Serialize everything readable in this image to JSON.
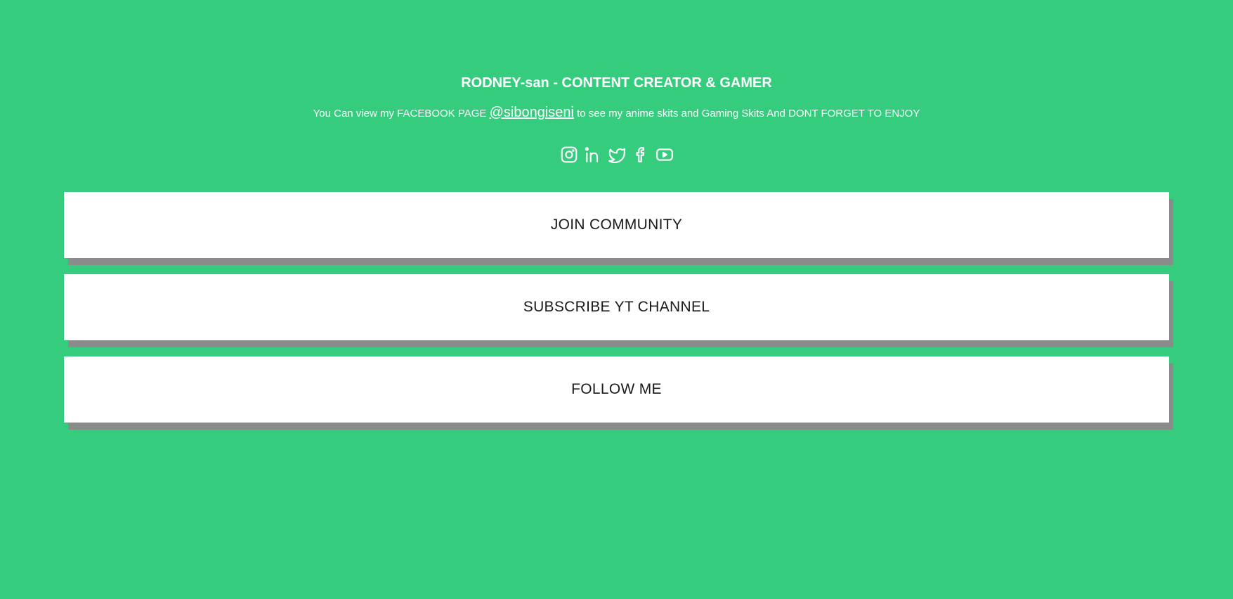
{
  "header": {
    "title": "RODNEY-san - CONTENT CREATOR & GAMER",
    "subtitle_before": "You Can view my FACEBOOK PAGE ",
    "facebook_handle": "@sibongiseni",
    "subtitle_after": " to see my anime skits and Gaming Skits And DONT FORGET TO ENJOY"
  },
  "social": {
    "icons": [
      "instagram-icon",
      "linkedin-icon",
      "twitter-icon",
      "facebook-icon",
      "youtube-icon"
    ],
    "icon_color": "#ffffff"
  },
  "buttons": {
    "join_community": "JOIN COMMUNITY",
    "subscribe_yt": "SUBSCRIBE YT CHANNEL",
    "follow_me": "FOLLOW ME"
  },
  "colors": {
    "background": "#35cd7d",
    "button_bg": "#ffffff",
    "button_shadow": "#8b8b8b",
    "button_text": "#1a1a1a"
  }
}
